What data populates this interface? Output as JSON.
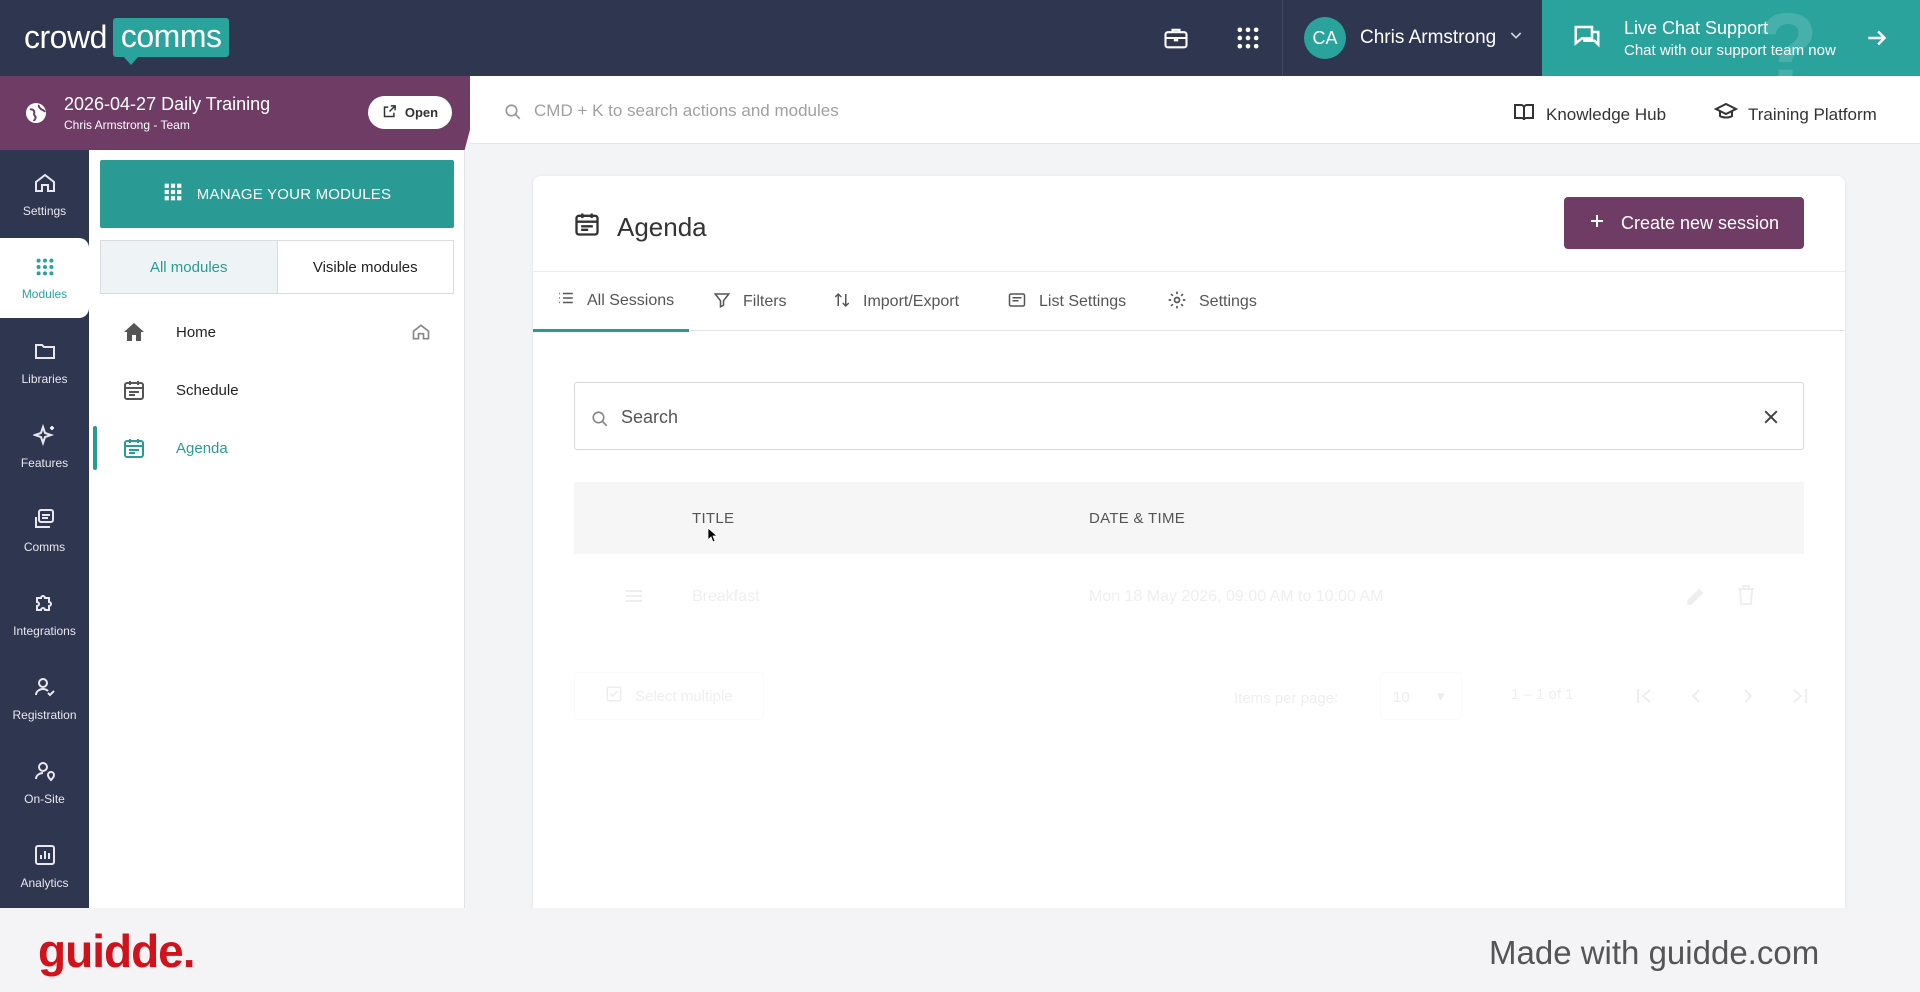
{
  "topbar": {
    "logo_text_1": "crowd",
    "logo_text_2": "comms",
    "user_initials": "CA",
    "user_name": "Chris Armstrong",
    "live_chat_title": "Live Chat Support",
    "live_chat_subtitle": "Chat with our support team now"
  },
  "event": {
    "name": "2026-04-27 Daily Training",
    "team": "Chris Armstrong - Team",
    "open_label": "Open"
  },
  "search": {
    "placeholder": "CMD + K to search actions and modules",
    "knowledge_hub": "Knowledge Hub",
    "training_platform": "Training Platform"
  },
  "rail": {
    "items": [
      {
        "label": "Settings",
        "icon": "home-icon"
      },
      {
        "label": "Modules",
        "icon": "grid-icon"
      },
      {
        "label": "Libraries",
        "icon": "folder-icon"
      },
      {
        "label": "Features",
        "icon": "sparkle-icon"
      },
      {
        "label": "Comms",
        "icon": "inbox-icon"
      },
      {
        "label": "Integrations",
        "icon": "puzzle-icon"
      },
      {
        "label": "Registration",
        "icon": "user-check-icon"
      },
      {
        "label": "On-Site",
        "icon": "location-user-icon"
      },
      {
        "label": "Analytics",
        "icon": "chart-icon"
      }
    ]
  },
  "modules": {
    "manage_label": "MANAGE YOUR MODULES",
    "seg_all": "All modules",
    "seg_visible": "Visible modules",
    "items": [
      {
        "label": "Home"
      },
      {
        "label": "Schedule"
      },
      {
        "label": "Agenda"
      }
    ]
  },
  "main": {
    "title": "Agenda",
    "create_label": "Create new session",
    "tabs": [
      {
        "label": "All Sessions"
      },
      {
        "label": "Filters"
      },
      {
        "label": "Import/Export"
      },
      {
        "label": "List Settings"
      },
      {
        "label": "Settings"
      }
    ],
    "search_placeholder": "Search",
    "col_title": "TITLE",
    "col_datetime": "DATE & TIME",
    "row_title": "Breakfast",
    "row_datetime": "Mon 18 May 2026, 09:00 AM to 10:00 AM",
    "select_multiple": "Select multiple",
    "items_per_page_label": "Items per page:",
    "items_per_page_value": "10",
    "range": "1 – 1 of 1"
  },
  "footer": {
    "brand": "guidde.",
    "made_with": "Made with guidde.com"
  },
  "colors": {
    "navy": "#2e3650",
    "teal": "#2aa39c",
    "plum": "#6e3c64"
  }
}
